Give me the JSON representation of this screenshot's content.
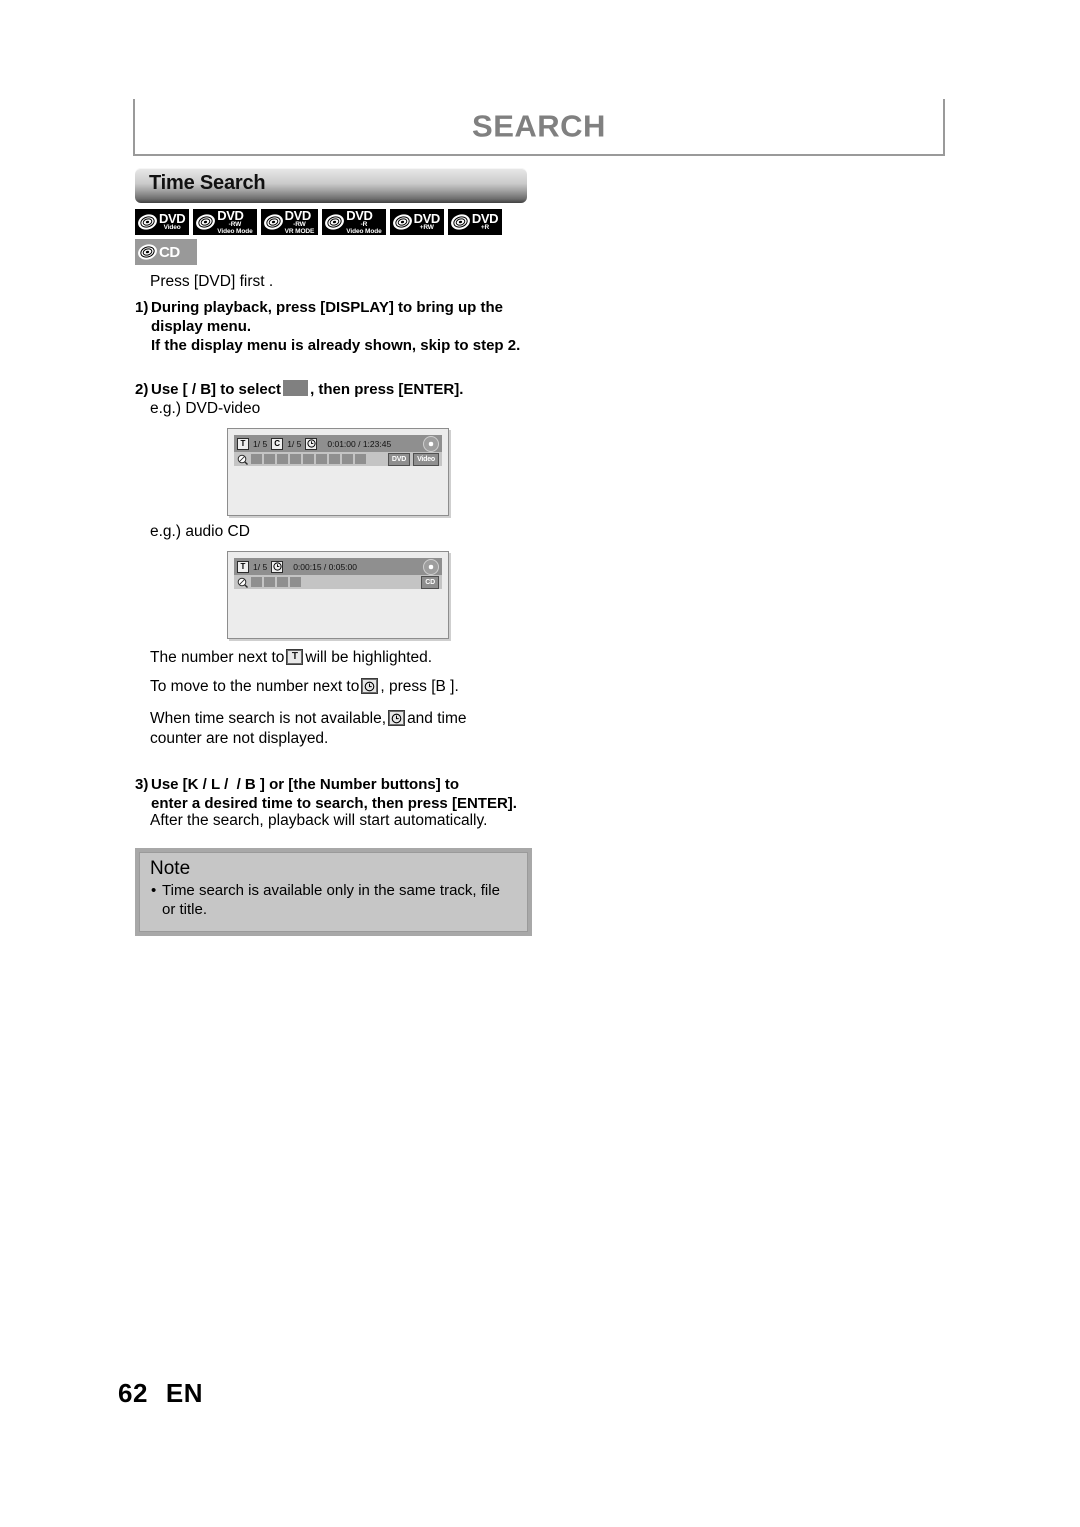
{
  "header": {
    "title": "SEARCH"
  },
  "section": {
    "title": "Time Search"
  },
  "disc_badges": [
    {
      "name": "dvd-video",
      "main": "DVD",
      "sub": "Video",
      "sub2": "",
      "style": "black"
    },
    {
      "name": "dvd-rw-video",
      "main": "DVD",
      "sub": "-RW",
      "sub2": "Video Mode",
      "style": "black"
    },
    {
      "name": "dvd-rw-vr",
      "main": "DVD",
      "sub": "-RW",
      "sub2": "VR MODE",
      "style": "black"
    },
    {
      "name": "dvd-r-video",
      "main": "DVD",
      "sub": "-R",
      "sub2": "Video Mode",
      "style": "black"
    },
    {
      "name": "dvd-plus-rw",
      "main": "DVD",
      "sub": "+RW",
      "sub2": "",
      "style": "black"
    },
    {
      "name": "dvd-plus-r",
      "main": "DVD",
      "sub": "+R",
      "sub2": "",
      "style": "black"
    },
    {
      "name": "audio-cd",
      "main": "CD",
      "sub": "",
      "sub2": "",
      "style": "gray"
    }
  ],
  "body": {
    "intro": "Press [DVD] first .",
    "step1": {
      "number": "1)",
      "line1": "During playback, press [DISPLAY] to bring up the",
      "line2": "display menu.",
      "line3": "If the display menu is already shown, skip to step 2."
    },
    "step2": {
      "number": "2)",
      "prefix": "Use [",
      "keys": "\u0003    / B",
      "mid": "] to select",
      "suffix": ", then press [ENTER]."
    },
    "eg_dvd": "e.g.) DVD-video",
    "eg_cd": "e.g.) audio CD",
    "para_a_pre": "The number next to",
    "para_a_icon": "T",
    "para_a_post": "will be highlighted.",
    "para_b_pre": "To move to the number next to",
    "para_b_post": ", press [B ].",
    "para_c_pre": "When time search is not available,",
    "para_c_post": "and time",
    "para_c_line2": "counter are not displayed.",
    "step3": {
      "number": "3)",
      "line1": "Use [K / L / \u0003   / B ] or [the Number buttons] to",
      "line2": "enter a desired time to search, then press [ENTER]."
    },
    "after_search": "After the search, playback will start automatically."
  },
  "osd_dvd": {
    "title_icon": "T",
    "title_value": "1/  5",
    "chapter_icon": "C",
    "chapter_value": "1/  5",
    "clock_icon": "clock",
    "time": "0:01:00 / 1:23:45",
    "block_count": 9,
    "tags": [
      "DVD",
      "Video"
    ]
  },
  "osd_cd": {
    "title_icon": "T",
    "title_value": "1/  5",
    "clock_icon": "clock",
    "time": "0:00:15 / 0:05:00",
    "block_count": 4,
    "tags": [
      "CD"
    ]
  },
  "note": {
    "title": "Note",
    "item1_line1": "Time search is available only in the same track, file or",
    "item1_line2": "title."
  },
  "footer": {
    "page": "62",
    "lang": "EN"
  },
  "colors": {
    "header_gray": "#808080",
    "note_bg": "#c6c6c6",
    "note_border": "#a8a8a8",
    "osd_bar_top": "#8f8f8f",
    "osd_bar_bottom": "#c4c4c4",
    "swatch": "#808080"
  }
}
